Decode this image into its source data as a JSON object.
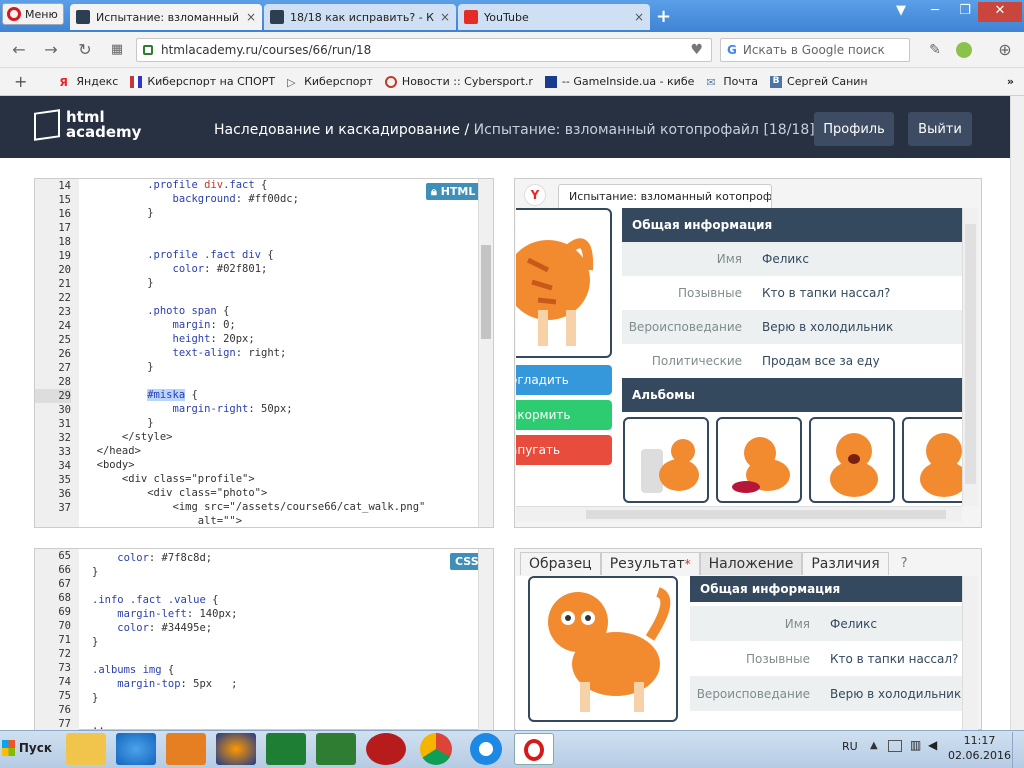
{
  "browser": {
    "menu_label": "Меню",
    "tabs": [
      {
        "title": "Испытание: взломанный кот",
        "active": true
      },
      {
        "title": "18/18 как исправить? - Курс",
        "active": false
      },
      {
        "title": "YouTube",
        "active": false
      }
    ],
    "url": "htmlacademy.ru/courses/66/run/18",
    "search_placeholder": "Искать в Google поиск",
    "bookmarks": [
      "Яндекс",
      "Киберспорт на СПОРТ",
      "Киберспорт",
      "Новости :: Cybersport.r",
      "-- GameInside.ua - кибе",
      "Почта",
      "Сергей Санин"
    ]
  },
  "site": {
    "logo_line1": "html",
    "logo_line2": "academy",
    "breadcrumb_section": "Наследование и каскадирование /",
    "breadcrumb_current": "Испытание: взломанный котопрофайл",
    "breadcrumb_progress": "[18/18]",
    "profile_button": "Профиль",
    "logout_button": "Выйти"
  },
  "html_editor": {
    "badge": "HTML",
    "lines": [
      {
        "n": "14",
        "t": "          .profile div.fact {"
      },
      {
        "n": "15",
        "t": "              background: #ff00dc;"
      },
      {
        "n": "16",
        "t": "          }"
      },
      {
        "n": "17",
        "t": "          "
      },
      {
        "n": "18",
        "t": "          "
      },
      {
        "n": "19",
        "t": "          .profile .fact div {"
      },
      {
        "n": "20",
        "t": "              color: #02f801;"
      },
      {
        "n": "21",
        "t": "          }"
      },
      {
        "n": "22",
        "t": "          "
      },
      {
        "n": "23",
        "t": "          .photo span {"
      },
      {
        "n": "24",
        "t": "              margin: 0;"
      },
      {
        "n": "25",
        "t": "              height: 20px;"
      },
      {
        "n": "26",
        "t": "              text-align: right;"
      },
      {
        "n": "27",
        "t": "          }"
      },
      {
        "n": "28",
        "t": "          "
      },
      {
        "n": "29",
        "t": "          #miska {"
      },
      {
        "n": "30",
        "t": "              margin-right: 50px;"
      },
      {
        "n": "31",
        "t": "          }"
      },
      {
        "n": "32",
        "t": "      </style>"
      },
      {
        "n": "33",
        "t": "  </head>"
      },
      {
        "n": "34",
        "t": "  <body>"
      },
      {
        "n": "35",
        "t": "      <div class=\"profile\">"
      },
      {
        "n": "36",
        "t": "          <div class=\"photo\">"
      },
      {
        "n": "37",
        "t": "              <img src=\"/assets/course66/cat_walk.png\""
      },
      {
        "n": "",
        "t": "                  alt=\"\">"
      }
    ]
  },
  "css_editor": {
    "badge": "CSS",
    "lines": [
      {
        "n": "65",
        "t": "    color: #7f8c8d;"
      },
      {
        "n": "66",
        "t": "}"
      },
      {
        "n": "67",
        "t": ""
      },
      {
        "n": "68",
        "t": ".info .fact .value {"
      },
      {
        "n": "69",
        "t": "    margin-left: 140px;"
      },
      {
        "n": "70",
        "t": "    color: #34495e;"
      },
      {
        "n": "71",
        "t": "}"
      },
      {
        "n": "72",
        "t": ""
      },
      {
        "n": "73",
        "t": ".albums img {"
      },
      {
        "n": "74",
        "t": "    margin-top: 5px   ;"
      },
      {
        "n": "75",
        "t": "}"
      },
      {
        "n": "76",
        "t": ""
      },
      {
        "n": "77",
        "t": ".."
      }
    ]
  },
  "preview": {
    "tab_title": "Испытание: взломанный котопроф",
    "info_header": "Общая информация",
    "facts": [
      {
        "key": "Имя",
        "value": "Феликс"
      },
      {
        "key": "Позывные",
        "value": "Кто в тапки нассал?"
      },
      {
        "key": "Вероисповедание",
        "value": "Верю в холодильник"
      },
      {
        "key": "Политические",
        "value": "Продам все за еду"
      }
    ],
    "actions": [
      "огладить",
      "акормить",
      "апугать"
    ],
    "action_colors": [
      "#3498db",
      "#2ecc71",
      "#e74c3c"
    ],
    "albums_header": "Альбомы"
  },
  "compare": {
    "tabs": [
      "Образец",
      "Результат",
      "Наложение",
      "Различия"
    ],
    "help": "?",
    "info_header": "Общая информация",
    "facts": [
      {
        "key": "Имя",
        "value": "Феликс"
      },
      {
        "key": "Позывные",
        "value": "Кто в тапки нассал?"
      },
      {
        "key": "Вероисповедание",
        "value": "Верю в холодильник"
      }
    ]
  },
  "taskbar": {
    "start": "Пуск",
    "lang": "RU",
    "time": "11:17",
    "date": "02.06.2016"
  },
  "colors": {
    "header_bg": "#283142",
    "accent": "#34495e",
    "badge": "#3f8fb8"
  }
}
